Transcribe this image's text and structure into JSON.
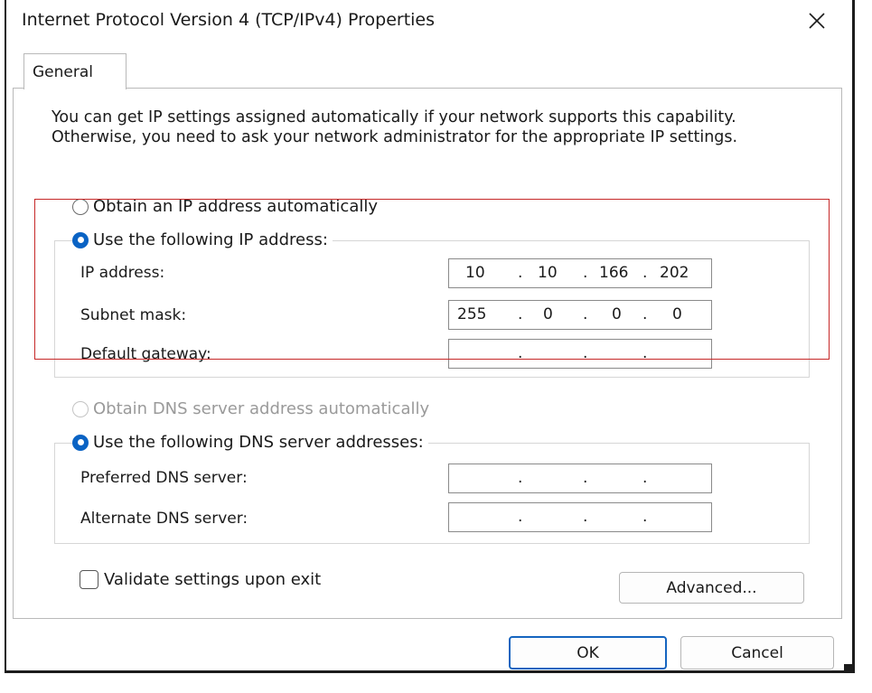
{
  "window": {
    "title": "Internet Protocol Version 4 (TCP/IPv4) Properties",
    "close_icon": "close-icon"
  },
  "tabs": [
    {
      "label": "General",
      "selected": true
    }
  ],
  "description": "You can get IP settings assigned automatically if your network supports this capability. Otherwise, you need to ask your network administrator for the appropriate IP settings.",
  "ip_section": {
    "auto_label": "Obtain an IP address automatically",
    "manual_label": "Use the following IP address:",
    "selected": "manual",
    "fields": [
      {
        "label": "IP address:",
        "octets": [
          "10",
          "10",
          "166",
          "202"
        ]
      },
      {
        "label": "Subnet mask:",
        "octets": [
          "255",
          "0",
          "0",
          "0"
        ]
      },
      {
        "label": "Default gateway:",
        "octets": [
          "",
          "",
          "",
          ""
        ]
      }
    ]
  },
  "dns_section": {
    "auto_label": "Obtain DNS server address automatically",
    "auto_enabled": false,
    "manual_label": "Use the following DNS server addresses:",
    "selected": "manual",
    "fields": [
      {
        "label": "Preferred DNS server:",
        "octets": [
          "",
          "",
          "",
          ""
        ]
      },
      {
        "label": "Alternate DNS server:",
        "octets": [
          "",
          "",
          "",
          ""
        ]
      }
    ]
  },
  "validate": {
    "label": "Validate settings upon exit",
    "checked": false
  },
  "buttons": {
    "advanced": "Advanced...",
    "ok": "OK",
    "cancel": "Cancel"
  },
  "colors": {
    "accent": "#0a63c4",
    "default_button_border": "#1565c0",
    "highlight_box": "#c62828"
  }
}
